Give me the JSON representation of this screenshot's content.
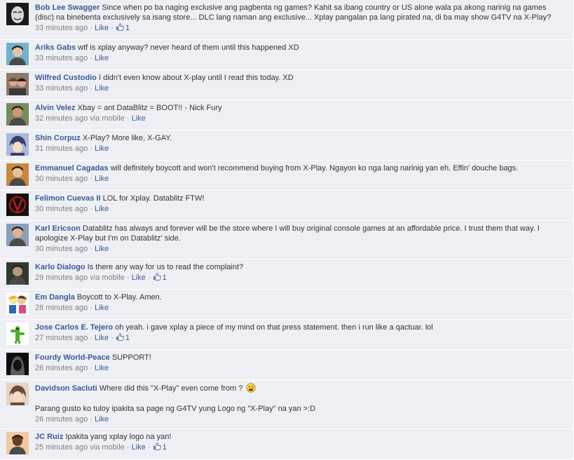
{
  "comments": [
    {
      "author": "Bob Lee Swagger",
      "text": "Since when po ba naging exclusive ang pagbenta ng games? Kahit sa ibang country or US alone wala pa akong narinig na games (disc) na binebenta exclusively sa isang store... DLC lang naman ang exclusive... Xplay pangalan pa lang pirated na, di ba may show G4TV na X-Play?",
      "time": "33 minutes ago",
      "via": "",
      "like_label": "Like",
      "likes": "1",
      "avatar_icon": "masked-face-avatar",
      "avatar_colors": [
        "#1a1a1a",
        "#d8d8d8"
      ]
    },
    {
      "author": "Ariks Gabs",
      "text": "wtf is xplay anyway? never heard of them until this happened XD",
      "time": "33 minutes ago",
      "via": "",
      "like_label": "Like",
      "likes": "",
      "avatar_icon": "person-avatar",
      "avatar_colors": [
        "#6fb3c9",
        "#e8c3a8"
      ]
    },
    {
      "author": "Wilfred Custodio",
      "text": "I didn't even know about X-play until I read this today. XD",
      "time": "33 minutes ago",
      "via": "",
      "like_label": "Like",
      "likes": "",
      "avatar_icon": "couple-avatar",
      "avatar_colors": [
        "#5a4636",
        "#d9a98a"
      ]
    },
    {
      "author": "Alvin Velez",
      "text": "Xbay = ant DataBlitz = BOOT!! - Nick Fury",
      "time": "32 minutes ago",
      "via": "via mobile",
      "like_label": "Like",
      "likes": "",
      "avatar_icon": "person-avatar",
      "avatar_colors": [
        "#7a8a5c",
        "#c99a77"
      ]
    },
    {
      "author": "Shin Corpuz",
      "text": "X-Play? More like, X-GAY.",
      "time": "31 minutes ago",
      "via": "",
      "like_label": "Like",
      "likes": "",
      "avatar_icon": "anime-avatar",
      "avatar_colors": [
        "#a9b9d9",
        "#3a3f6b"
      ]
    },
    {
      "author": "Emmanuel Cagadas",
      "text": "will definitely boycott and won't recommend buying from X-Play. Ngayon ko nga lang narinig yan eh. Effin' douche bags.",
      "time": "30 minutes ago",
      "via": "",
      "like_label": "Like",
      "likes": "",
      "avatar_icon": "person-avatar",
      "avatar_colors": [
        "#c78a3c",
        "#e6c29a"
      ]
    },
    {
      "author": "Felimon Cuevas II",
      "text": "LOL for Xplay. Datablitz FTW!",
      "time": "30 minutes ago",
      "via": "",
      "like_label": "Like",
      "likes": "",
      "avatar_icon": "v-symbol-avatar",
      "avatar_colors": [
        "#111111",
        "#c01818"
      ]
    },
    {
      "author": "Karl Ericson",
      "text": "Datablitz has always and forever will be the store where I will buy original console games at an affordable price. I trust them that way. I apologize X-Play but I'm on Datablitz' side.",
      "time": "30 minutes ago",
      "via": "",
      "like_label": "Like",
      "likes": "",
      "avatar_icon": "person-avatar",
      "avatar_colors": [
        "#8aa0b8",
        "#d8b494"
      ]
    },
    {
      "author": "Karlo Dialogo",
      "text": "Is there any way for us to read the complaint?",
      "time": "29 minutes ago",
      "via": "via mobile",
      "like_label": "Like",
      "likes": "1",
      "avatar_icon": "person-avatar",
      "avatar_colors": [
        "#2f3a2c",
        "#b89a7e"
      ]
    },
    {
      "author": "Em Dangla",
      "text": "Boycott to X-Play. Amen.",
      "time": "28 minutes ago",
      "via": "",
      "like_label": "Like",
      "likes": "",
      "avatar_icon": "cartoon-avatar",
      "avatar_colors": [
        "#f4e6a0",
        "#2a6bb8"
      ]
    },
    {
      "author": "Jose Carlos E. Tejero",
      "text": "oh yeah. i gave xplay a piece of my mind on that press statement. then i run like a qactuar. lol",
      "time": "27 minutes ago",
      "via": "",
      "like_label": "Like",
      "likes": "1",
      "avatar_icon": "cactuar-avatar",
      "avatar_colors": [
        "#ffffff",
        "#4caf2e"
      ]
    },
    {
      "author": "Fourdy World-Peace",
      "text": "SUPPORT!",
      "time": "26 minutes ago",
      "via": "",
      "like_label": "Like",
      "likes": "",
      "avatar_icon": "hooded-avatar",
      "avatar_colors": [
        "#0d0d0d",
        "#5a5a5a"
      ]
    },
    {
      "author": "Davidson Sacluti",
      "text": "Where did this \"X-Play\" even come from ?",
      "extra_text": "Parang gusto ko tuloy ipakita sa page ng G4TV yung Logo ng \"X-Play\" na yan >:D",
      "time": "26 minutes ago",
      "via": "",
      "like_label": "Like",
      "likes": "",
      "avatar_icon": "anime-avatar",
      "avatar_colors": [
        "#e7d3c0",
        "#6b4a3a"
      ]
    },
    {
      "author": "JC Ruiz",
      "text": "Ipakita yang xplay logo na yan!",
      "time": "25 minutes ago",
      "via": "via mobile",
      "like_label": "Like",
      "likes": "1",
      "avatar_icon": "person-avatar",
      "avatar_colors": [
        "#f2c8a0",
        "#6a3b22"
      ]
    }
  ],
  "colors": {
    "background": "#edeff4",
    "author": "#3b5998",
    "meta": "#808080",
    "text": "#333333"
  }
}
